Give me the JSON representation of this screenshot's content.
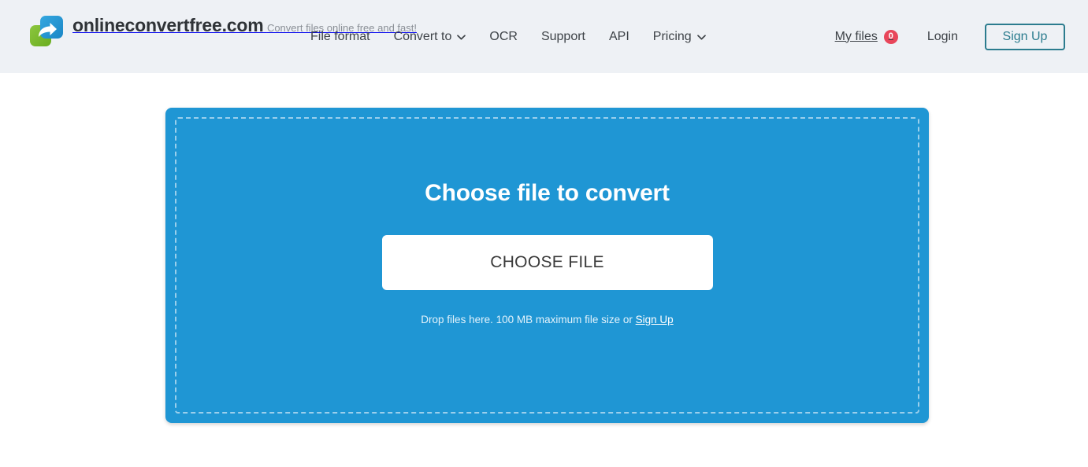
{
  "header": {
    "logo": {
      "icon_name": "convert-arrow-logo-icon",
      "title": "onlineconvertfree.com",
      "tagline": "Convert files online free and fast!"
    },
    "nav": [
      {
        "label": "File format",
        "has_dropdown": false
      },
      {
        "label": "Convert to",
        "has_dropdown": true
      },
      {
        "label": "OCR",
        "has_dropdown": false
      },
      {
        "label": "Support",
        "has_dropdown": false
      },
      {
        "label": "API",
        "has_dropdown": false
      },
      {
        "label": "Pricing",
        "has_dropdown": true
      }
    ],
    "my_files": {
      "label": "My files",
      "count": "0"
    },
    "login_label": "Login",
    "signup_label": "Sign Up"
  },
  "main": {
    "dropzone": {
      "title": "Choose file to convert",
      "choose_file_label": "CHOOSE FILE",
      "hint_text": "Drop files here. 100 MB maximum file size or",
      "hint_link": "Sign Up"
    }
  },
  "colors": {
    "header_bg": "#eef1f5",
    "accent_blue": "#1f96d4",
    "badge_red": "#e8465a",
    "signup_teal": "#2b7c8e",
    "logo_green": "#7ab929",
    "logo_blue": "#2196d3",
    "text_dark": "#3d4247",
    "text_muted": "#8b9097"
  }
}
